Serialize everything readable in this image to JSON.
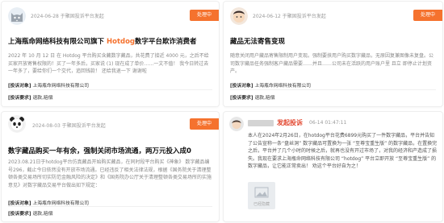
{
  "cards": [
    {
      "date": "2024-06-28",
      "source": "于聚固投诉平台发起",
      "status": "处理中",
      "title_prefix": "上海瓶命网络科技有限公司旗下",
      "title_highlight": "Hotdog",
      "title_suffix": "数字平台欺诈消费者",
      "summary": "2022 年 10 月 12 日 在 Hotdog 平台购买含藏数字藏品，共花费了接近 4000 元，之后不给买家开放寄售权限的！买了一年多后，买家说 (1) 现在成了单价……一文不值！ 我今日转过去一年多了，要给你们一个交代，追回钱款！ 还给我退一下 谢谢啦",
      "complaint_target_label": "[投诉对象]",
      "complaint_target": "上海瓶命网络科技有限公司",
      "demand_label": "[投诉要求]",
      "demand": "退款,赔偿"
    },
    {
      "date": "2024-06-12",
      "source": "于聚固投诉平台发起",
      "status": "处理中",
      "title": "藏品无法寄售变现",
      "summary": "随意关闭用户藏品寄售限制用户变现。强制要挟用户购买数字藏品，无原因复兼图像未复盘。公司数字藏品任务强制客户藏品需要……并且……公司未在活跃的用户账户里 且立 即停止计划资产。",
      "complaint_target_label": "[投诉对象]",
      "complaint_target": "上海瓶命网络科技有限公司",
      "demand_label": "[投诉要求]",
      "demand": "退款,赔偿"
    },
    {
      "date": "2024-08-03",
      "source": "于聚固投诉平台发起",
      "status": "处理中",
      "title": "数字藏品购买一年有余，强制关闭市场流通，两万元投入成0",
      "summary": "2023.08.21日于hotdog平台仿真藏品开始购买藏品，在同时段平台购买《神象》 数字藏品编号296，截止今日依然没有开放市场流通。已经违反了相关法律法规，根据《国务院关于清理整顿各类交易场所切实防范金融风险的决定》和《国务院办公厅关于清理整顿各类交易场所的实施意见》对数字藏品交易平台做出如下规定：",
      "complaint_target_label": "[投诉对象]",
      "complaint_target": "上海瓶命网络科技有限公司",
      "demand_label": "[投诉要求]",
      "demand": "退款,赔偿"
    },
    {
      "tag": "发起投诉",
      "time": "06-14 01:47:11",
      "body": "本人在2024年2月26日，在hotdog平台花费6899元购买了一件数字藏品，平台并告知了公告宣称一条“盘丝洞” 数字藏品可置换为一张 “至尊宝重生版” 的数字藏品，在置换完之后，平台并了几个小时的时候之后，就再也没有开过市场了，对我的经济和产造成了损失。我现在要求上海瓶命网络科技有限公司 “hotdog” 平台立即开放 “至尊宝重生版” 的数字藏品，让它能正常卖出！ 劝这个平台好自为之！",
      "image_caption": "已经隐藏"
    }
  ],
  "colors": {
    "accent": "#f5722e",
    "tag_red": "#e2462e"
  }
}
